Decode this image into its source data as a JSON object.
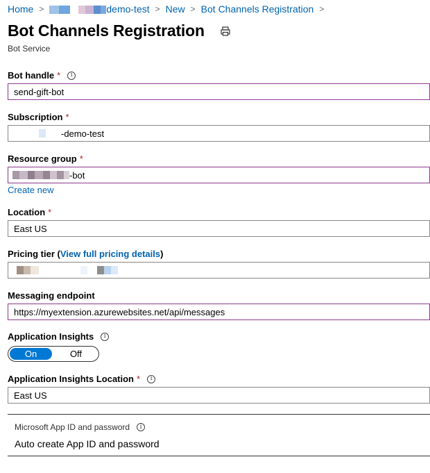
{
  "breadcrumb": {
    "items": [
      "Home",
      "demo-test",
      "New",
      "Bot Channels Registration"
    ]
  },
  "header": {
    "title": "Bot Channels Registration",
    "subtitle": "Bot Service"
  },
  "form": {
    "bot_handle": {
      "label": "Bot handle",
      "value": "send-gift-bot"
    },
    "subscription": {
      "label": "Subscription",
      "value": "-demo-test"
    },
    "resource_group": {
      "label": "Resource group",
      "value": "-bot",
      "create_new": "Create new"
    },
    "location": {
      "label": "Location",
      "value": "East US"
    },
    "pricing_tier": {
      "label_prefix": "Pricing tier (",
      "link": "View full pricing details",
      "label_suffix": ")"
    },
    "messaging_endpoint": {
      "label": "Messaging endpoint",
      "value": "https://myextension.azurewebsites.net/api/messages"
    },
    "app_insights": {
      "label": "Application Insights",
      "on": "On",
      "off": "Off",
      "selected": "On"
    },
    "app_insights_location": {
      "label": "Application Insights Location",
      "value": "East US"
    },
    "app_id": {
      "label": "Microsoft App ID and password",
      "value": "Auto create App ID and password"
    }
  },
  "required_marker": "*",
  "colors": {
    "link": "#0063b1",
    "required": "#a4262c",
    "toggle_on": "#0078d4",
    "active_border": "#8b3a8c"
  },
  "icons": [
    "chevron-right-icon",
    "print-icon",
    "info-icon"
  ]
}
